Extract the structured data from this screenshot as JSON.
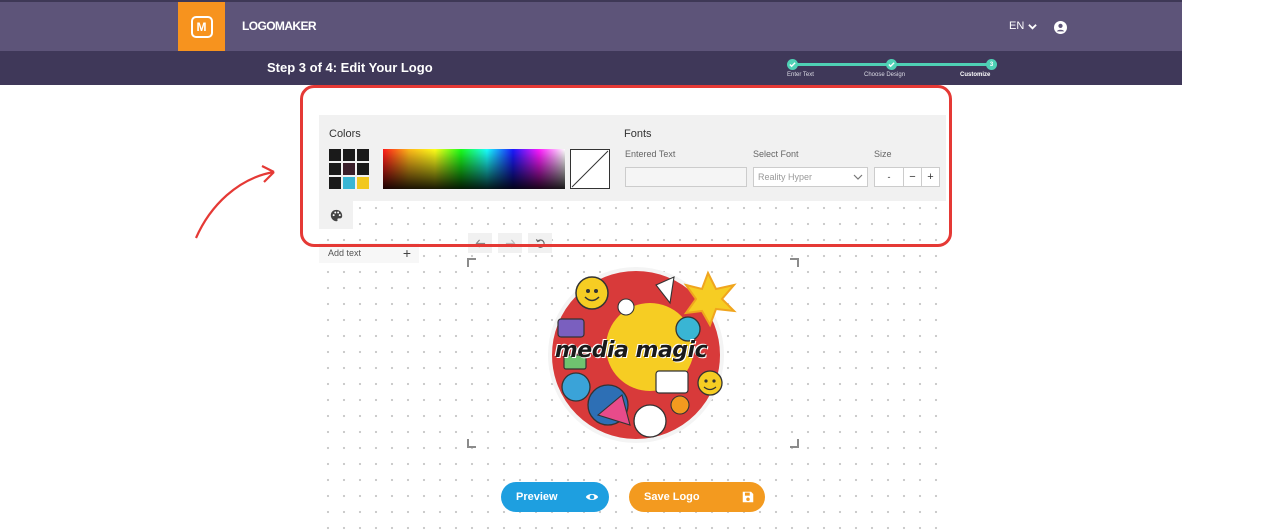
{
  "header": {
    "brand": "LOGOMAKER",
    "logo_letter": "M",
    "language": "EN"
  },
  "step": {
    "title": "Step 3 of 4: Edit Your Logo",
    "steps": [
      {
        "label": "Enter Text",
        "state": "done"
      },
      {
        "label": "Choose Design",
        "state": "done"
      },
      {
        "label": "Customize",
        "state": "active",
        "number": "3"
      }
    ]
  },
  "colors": {
    "title": "Colors",
    "swatches": [
      "#1a1a1a",
      "#1a1a1a",
      "#1a1a1a",
      "#1a1a1a",
      "#3a1f2a",
      "#1a1a1a",
      "#1a1a1a",
      "#39b5d4",
      "#f2c81e"
    ]
  },
  "fonts": {
    "title": "Fonts",
    "entered_text_label": "Entered Text",
    "entered_text_value": "",
    "select_font_label": "Select Font",
    "select_font_value": "Reality Hyper",
    "size_label": "Size",
    "size_value": "-",
    "minus": "−",
    "plus": "+"
  },
  "toolbar": {
    "add_text_label": "Add text",
    "add_plus": "+"
  },
  "logo": {
    "text": "media magic"
  },
  "actions": {
    "preview_label": "Preview",
    "save_label": "Save Logo"
  },
  "theme": {
    "nav": "#5d5479",
    "subnav": "#3f3859",
    "accent_orange": "#f7931e",
    "progress": "#4fd1b5",
    "preview_blue": "#1e9fe0",
    "highlight_red": "#e53935"
  }
}
